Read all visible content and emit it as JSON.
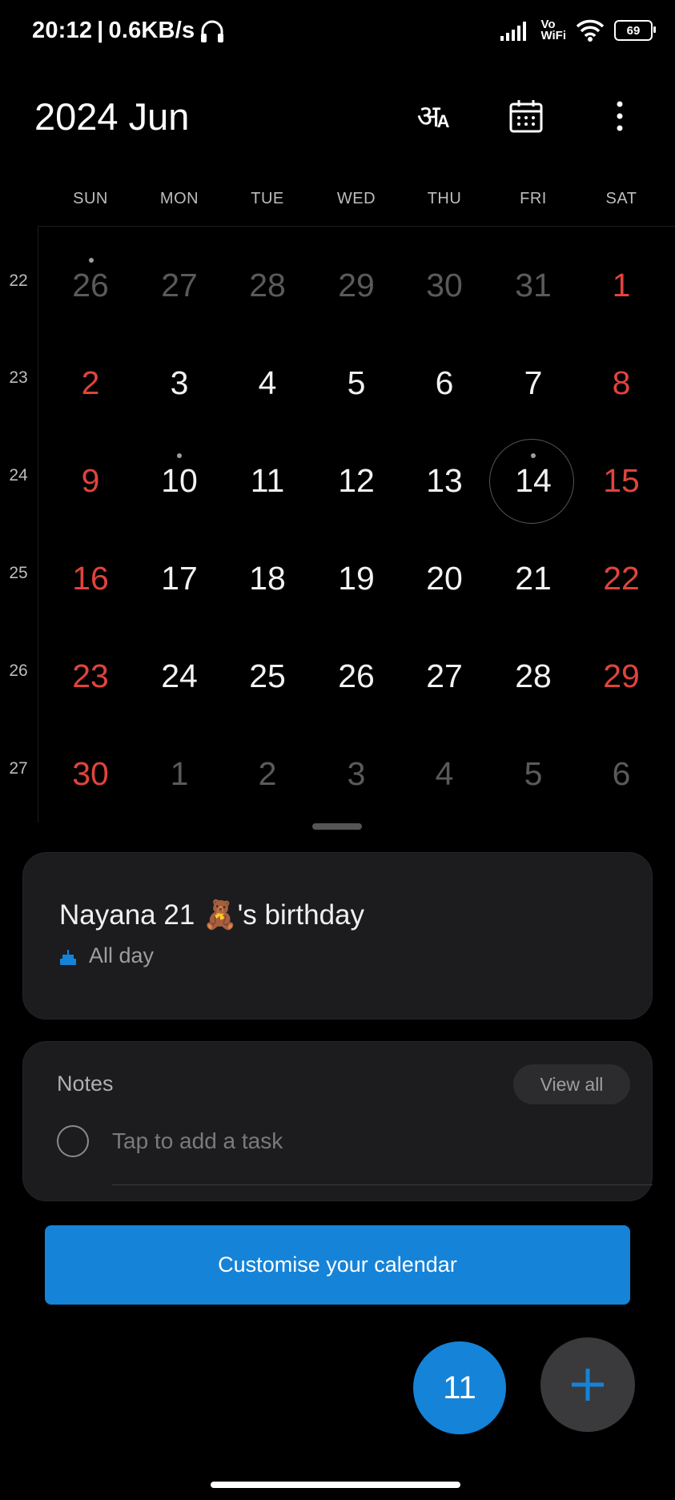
{
  "status_bar": {
    "time": "20:12",
    "speed": "0.6KB/s",
    "vowifi_top": "Vo",
    "vowifi_bottom": "WiFi",
    "battery": "69"
  },
  "header": {
    "title": "2024 Jun",
    "translate_glyph": "अ",
    "translate_sub": "A"
  },
  "weekdays": [
    "SUN",
    "MON",
    "TUE",
    "WED",
    "THU",
    "FRI",
    "SAT"
  ],
  "week_numbers": [
    "22",
    "23",
    "24",
    "25",
    "26",
    "27"
  ],
  "weeks": [
    [
      "26",
      "27",
      "28",
      "29",
      "30",
      "31",
      "1"
    ],
    [
      "2",
      "3",
      "4",
      "5",
      "6",
      "7",
      "8"
    ],
    [
      "9",
      "10",
      "11",
      "12",
      "13",
      "14",
      "15"
    ],
    [
      "16",
      "17",
      "18",
      "19",
      "20",
      "21",
      "22"
    ],
    [
      "23",
      "24",
      "25",
      "26",
      "27",
      "28",
      "29"
    ],
    [
      "30",
      "1",
      "2",
      "3",
      "4",
      "5",
      "6"
    ]
  ],
  "event": {
    "title": "Nayana 21 🧸's birthday",
    "subtitle": "All day"
  },
  "notes": {
    "label": "Notes",
    "view_all": "View all",
    "placeholder": "Tap to add a task"
  },
  "cta": "Customise your calendar",
  "fab_today": "11",
  "colors": {
    "accent": "#1583d8",
    "weekend": "#e0443c",
    "background": "#000000",
    "card": "#1c1c1e"
  }
}
